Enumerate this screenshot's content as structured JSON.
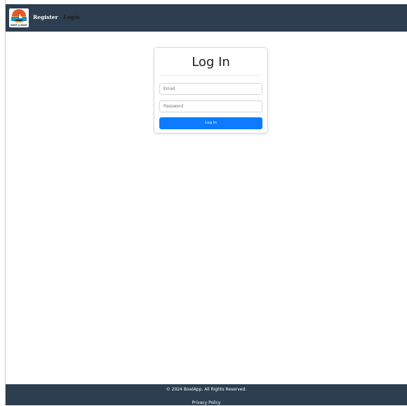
{
  "nav": {
    "logo_icon": "boat-sunset-logo",
    "logo_text": "RENT A BOAT",
    "register_label": "Register",
    "login_label": "Login",
    "background": "#2c3e50"
  },
  "login": {
    "title": "Log In",
    "email_placeholder": "Email",
    "password_placeholder": "Password",
    "submit_label": "Log In",
    "button_color": "#0d7bfb"
  },
  "footer": {
    "copyright": "© 2024 BoatApp. All Rights Reserved.",
    "privacy_label": "Privacy Policy"
  }
}
